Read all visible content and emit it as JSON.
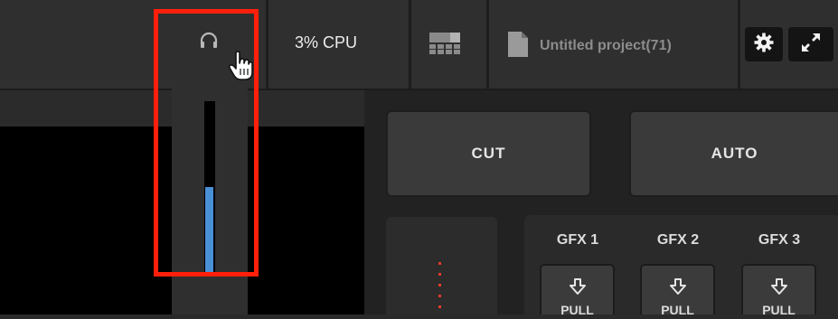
{
  "topbar": {
    "cpu": "3% CPU",
    "project_title": "Untitled project(71)",
    "audio_icon": "headphones-icon",
    "layout_icon": "multiview-layout-icon",
    "settings_icon": "gear-icon",
    "fullscreen_icon": "expand-icon"
  },
  "audio_meter": {
    "level": 0.5,
    "fill_color": "#4a90d6"
  },
  "highlight_color": "#ff1f0a",
  "transitions": {
    "cut": "CUT",
    "auto": "AUTO"
  },
  "gfx": [
    {
      "label": "GFX 1",
      "pull": "PULL"
    },
    {
      "label": "GFX 2",
      "pull": "PULL"
    },
    {
      "label": "GFX 3",
      "pull": "PULL"
    }
  ]
}
